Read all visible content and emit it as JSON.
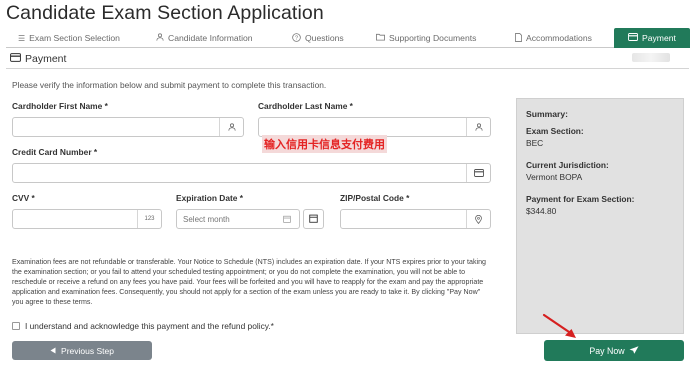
{
  "title": "Candidate Exam Section Application",
  "tabs": [
    {
      "label": "Exam Section Selection",
      "icon": "list-icon"
    },
    {
      "label": "Candidate Information",
      "icon": "person-icon"
    },
    {
      "label": "Questions",
      "icon": "question-icon"
    },
    {
      "label": "Supporting Documents",
      "icon": "folder-icon"
    },
    {
      "label": "Accommodations",
      "icon": "document-icon"
    },
    {
      "label": "Payment",
      "icon": "credit-card-icon",
      "active": true
    }
  ],
  "section": {
    "title": "Payment",
    "icon": "credit-card-icon"
  },
  "instructions": "Please verify the information below and submit payment to complete this transaction.",
  "form": {
    "first_name": {
      "label": "Cardholder First Name *",
      "value": "",
      "icon": "person-icon"
    },
    "last_name": {
      "label": "Cardholder Last Name *",
      "value": "",
      "icon": "person-icon"
    },
    "card_number": {
      "label": "Credit Card Number *",
      "value": "",
      "icon": "credit-card-icon"
    },
    "cvv": {
      "label": "CVV *",
      "value": "",
      "icon_text": "123"
    },
    "expiration": {
      "label": "Expiration Date *",
      "placeholder": "Select month",
      "icon": "calendar-icon"
    },
    "zip": {
      "label": "ZIP/Postal Code *",
      "value": "",
      "icon": "location-pin-icon"
    }
  },
  "annotation": "输入信用卡信息支付费用",
  "policy_text": "Examination fees are not refundable or transferable. Your Notice to Schedule (NTS) includes an expiration date. If your NTS expires prior to your taking the examination section; or you fail to attend your scheduled testing appointment; or you do not complete the examination, you will not be able to reschedule or receive a refund on any fees you have paid. Your fees will be forfeited and you will have to reapply for the exam and pay the appropriate application and examination fees. Consequently, you should not apply for a section of the exam unless you are ready to take it. By clicking \"Pay Now\" you agree to these terms.",
  "acknowledge": {
    "label": "I understand and acknowledge this payment and the refund policy.*",
    "checked": false
  },
  "summary": {
    "heading": "Summary:",
    "exam_section_label": "Exam Section:",
    "exam_section_value": "BEC",
    "jurisdiction_label": "Current Jurisdiction:",
    "jurisdiction_value": "Vermont BOPA",
    "payment_label": "Payment for Exam Section:",
    "payment_value": "$344.80"
  },
  "buttons": {
    "previous": "Previous Step",
    "pay_now": "Pay Now"
  },
  "colors": {
    "accent": "#217a5a",
    "secondary_button": "#7b848c",
    "summary_bg": "#e1e1e1",
    "annotation_text": "#e42424",
    "annotation_bg": "#f4d9d9",
    "arrow": "#d62020"
  }
}
